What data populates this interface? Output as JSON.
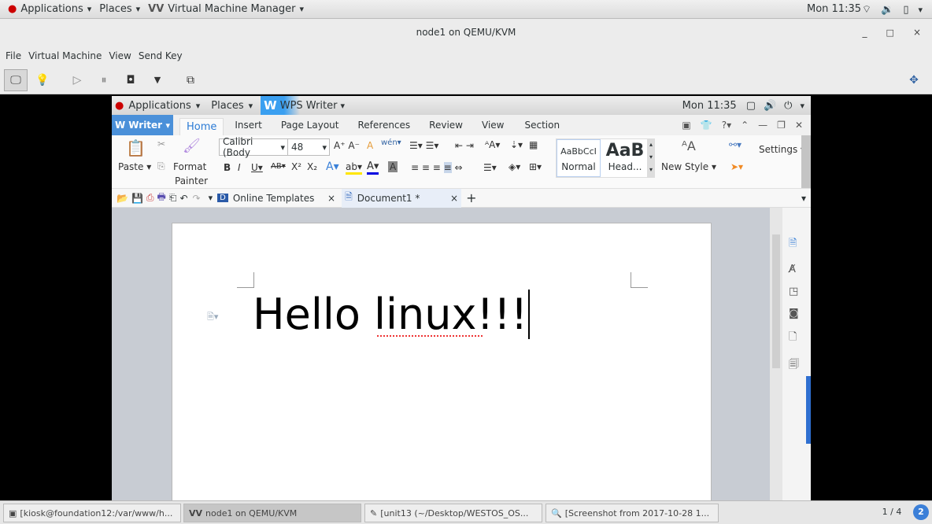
{
  "topbar": {
    "applications": "Applications",
    "places": "Places",
    "app": "Virtual Machine Manager",
    "clock": "Mon 11:35"
  },
  "window": {
    "title": "node1 on QEMU/KVM",
    "minimize": "_",
    "maximize": "□",
    "close": "×"
  },
  "menu": [
    "File",
    "Virtual Machine",
    "View",
    "Send Key"
  ],
  "guest": {
    "topbar": {
      "applications": "Applications",
      "places": "Places",
      "app": "WPS Writer",
      "clock": "Mon 11:35"
    },
    "writer_button": "Writer",
    "tabs": [
      "Home",
      "Insert",
      "Page Layout",
      "References",
      "Review",
      "View",
      "Section"
    ],
    "active_tab": "Home",
    "ribbon": {
      "paste": "Paste",
      "format_painter_1": "Format",
      "format_painter_2": "Painter",
      "font": "Calibri (Body",
      "size": "48",
      "style_normal_preview": "AaBbCcI",
      "style_normal": "Normal",
      "style_heading_preview": "AaB",
      "style_heading": "Head...",
      "new_style": "New Style",
      "settings": "Settings"
    },
    "doc_tabs": [
      {
        "label": "Online Templates"
      },
      {
        "label": "Document1 *"
      }
    ],
    "document_text": "Hello linux!!!"
  },
  "taskbar": {
    "items": [
      "[kiosk@foundation12:/var/www/h...",
      "node1 on QEMU/KVM",
      "[unit13 (~/Desktop/WESTOS_OS...",
      "[Screenshot from 2017-10-28 1..."
    ],
    "workspace": "1 / 4",
    "badge": "2"
  }
}
